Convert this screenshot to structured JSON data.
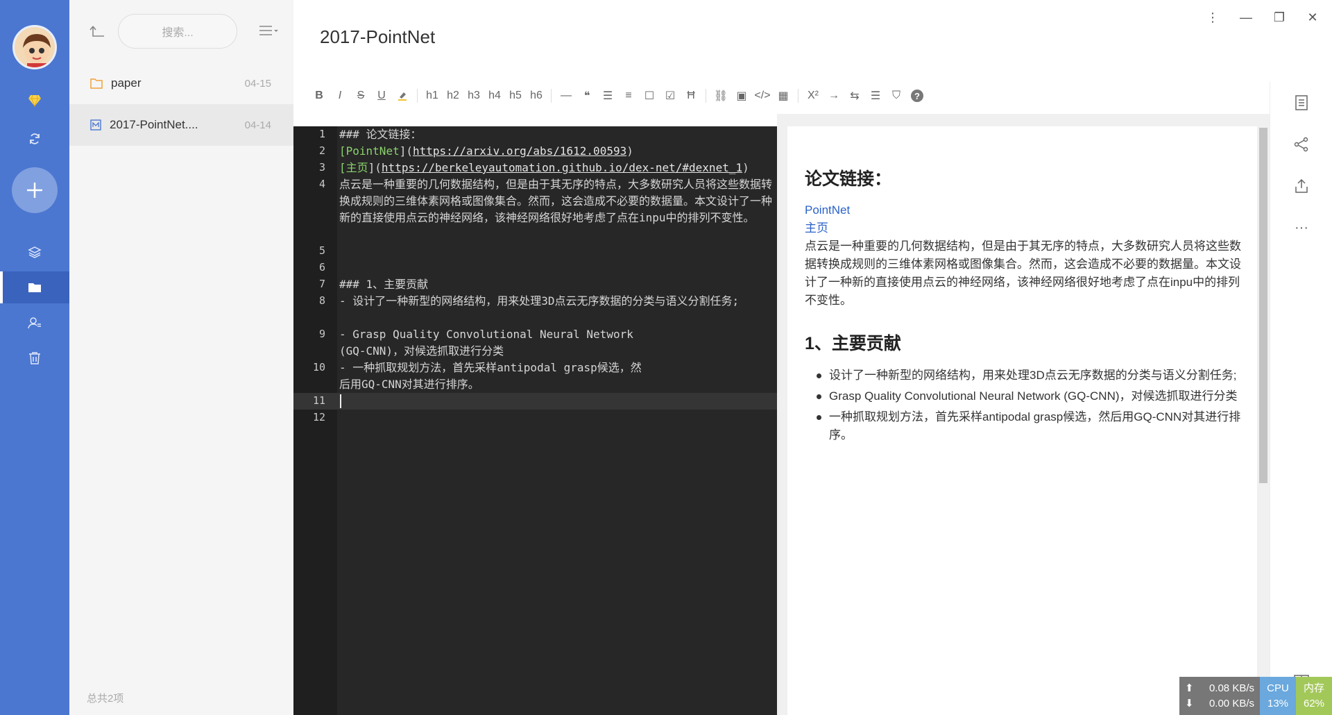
{
  "list": {
    "search_placeholder": "搜索...",
    "items": [
      {
        "name": "paper",
        "date": "04-15"
      },
      {
        "name": "2017-PointNet....",
        "date": "04-14"
      }
    ],
    "footer": "总共2项"
  },
  "note": {
    "title": "2017-PointNet"
  },
  "toolbar": {
    "buttons": [
      "B",
      "I",
      "S",
      "U",
      "h1",
      "h2",
      "h3",
      "h4",
      "h5",
      "h6",
      "X²",
      "?"
    ]
  },
  "editor": {
    "line_numbers": [
      "1",
      "2",
      "3",
      "4",
      "5",
      "6",
      "7",
      "8",
      "9",
      "10",
      "11",
      "12"
    ],
    "lines": {
      "l1": "### 论文链接：",
      "l2_text": "PointNet",
      "l2_url": "https://arxiv.org/abs/1612.00593",
      "l3_text": "主页",
      "l3_url": "https://berkeleyautomation.github.io/dex-net/#dexnet_1",
      "l4": "点云是一种重要的几何数据结构，但是由于其无序的特点，大多数研究人员将这些数据转换成规则的三维体素网格或图像集合。然而，这会造成不必要的数据量。本文设计了一种新的直接使用点云的神经网络，该神经网络很好地考虑了点在inpu中的排列不变性。",
      "l7": "### 1、主要贡献",
      "l8": "- 设计了一种新型的网络结构，用来处理3D点云无序数据的分类与语义分割任务;",
      "l9": "- Grasp Quality Convolutional Neural Network (GQ-CNN)，对候选抓取进行分类",
      "l10": "- 一种抓取规划方法，首先采样antipodal grasp候选，然后用GQ-CNN对其进行排序。"
    }
  },
  "preview": {
    "h_links": "论文链接：",
    "link1": "PointNet",
    "link2": "主页",
    "para": "点云是一种重要的几何数据结构，但是由于其无序的特点，大多数研究人员将这些数据转换成规则的三维体素网格或图像集合。然而，这会造成不必要的数据量。本文设计了一种新的直接使用点云的神经网络，该神经网络很好地考虑了点在inpu中的排列不变性。",
    "h_contrib": "1、主要贡献",
    "bullets": [
      "设计了一种新型的网络结构，用来处理3D点云无序数据的分类与语义分割任务;",
      "Grasp Quality Convolutional Neural Network (GQ-CNN)，对候选抓取进行分类",
      "一种抓取规划方法，首先采样antipodal grasp候选，然后用GQ-CNN对其进行排序。"
    ]
  },
  "netmon": {
    "up_rate": "0.08 KB/s",
    "down_rate": "0.00 KB/s",
    "cpu_label": "CPU",
    "cpu_value": "13%",
    "mem_label": "内存",
    "mem_value": "62%"
  },
  "colors": {
    "rail": "#4b77d1",
    "editor_bg": "#272727",
    "heading_green": "#8bd36c",
    "link_blue": "#2a62c9"
  }
}
